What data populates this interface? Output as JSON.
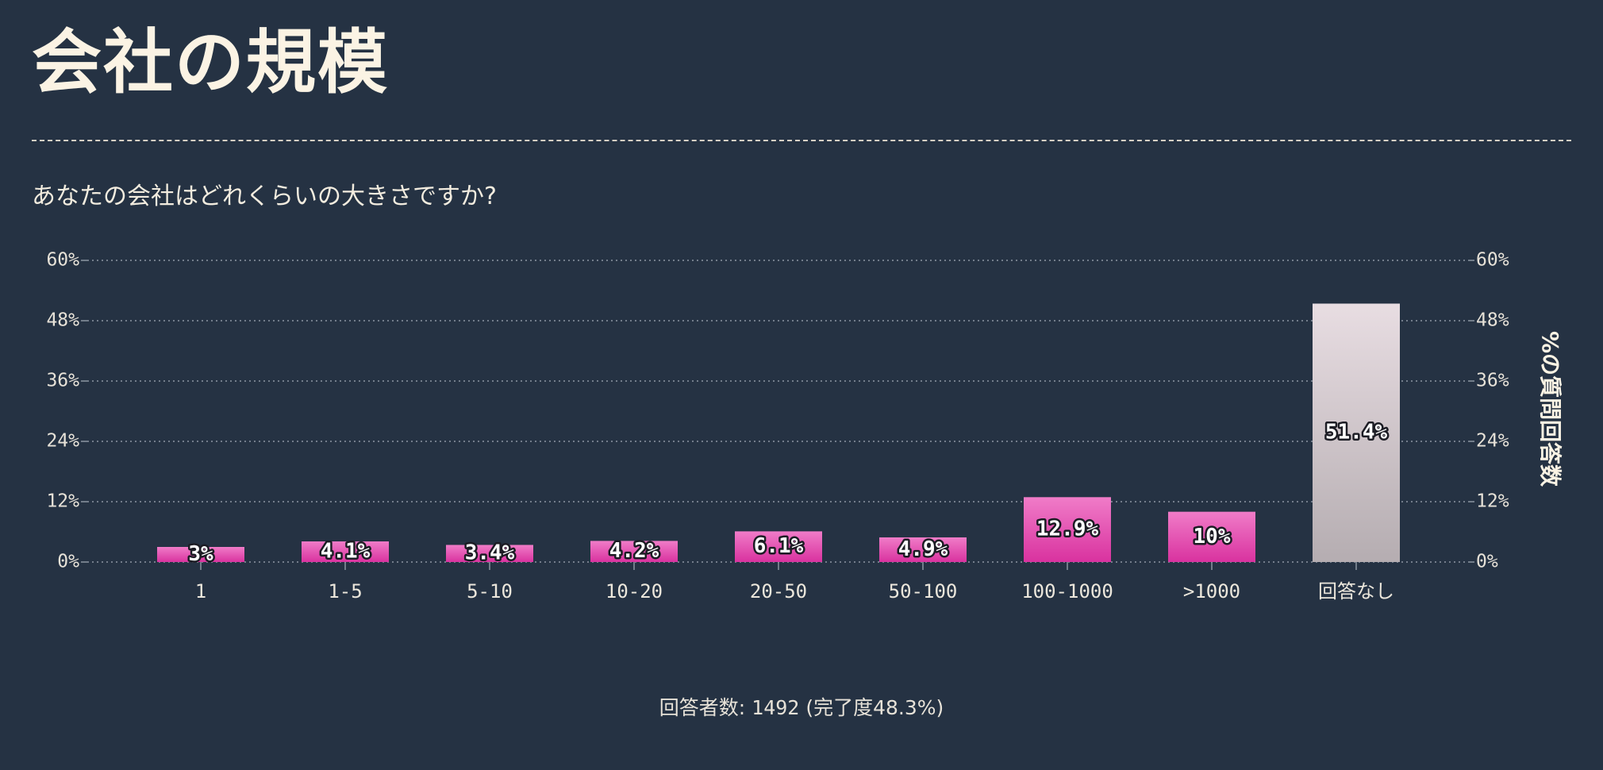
{
  "page": {
    "title": "会社の規模",
    "question": "あなたの会社はどれくらいの大きさですか?"
  },
  "footer": {
    "label": "回答者数:",
    "count": "1492",
    "completion": "(完了度48.3%)"
  },
  "colors": {
    "background": "#253243",
    "bar_pink_top": "#f07cc8",
    "bar_pink_bottom": "#d9329f",
    "bar_gray_top": "#e8dde2",
    "bar_gray_bottom": "#b5adb1",
    "grid": "#8d96a3"
  },
  "chart_data": {
    "type": "bar",
    "categories": [
      "1",
      "1-5",
      "5-10",
      "10-20",
      "20-50",
      "50-100",
      "100-1000",
      ">1000",
      "回答なし"
    ],
    "values": [
      3,
      4.1,
      3.4,
      4.2,
      6.1,
      4.9,
      12.9,
      10,
      51.4
    ],
    "value_labels": [
      "3%",
      "4.1%",
      "3.4%",
      "4.2%",
      "6.1%",
      "4.9%",
      "12.9%",
      "10%",
      "51.4%"
    ],
    "highlight_last": true,
    "ylim": [
      0,
      60
    ],
    "yticks": [
      "0%",
      "12%",
      "24%",
      "36%",
      "48%",
      "60%"
    ],
    "y2label": "%の質問回答数",
    "grid": true
  }
}
